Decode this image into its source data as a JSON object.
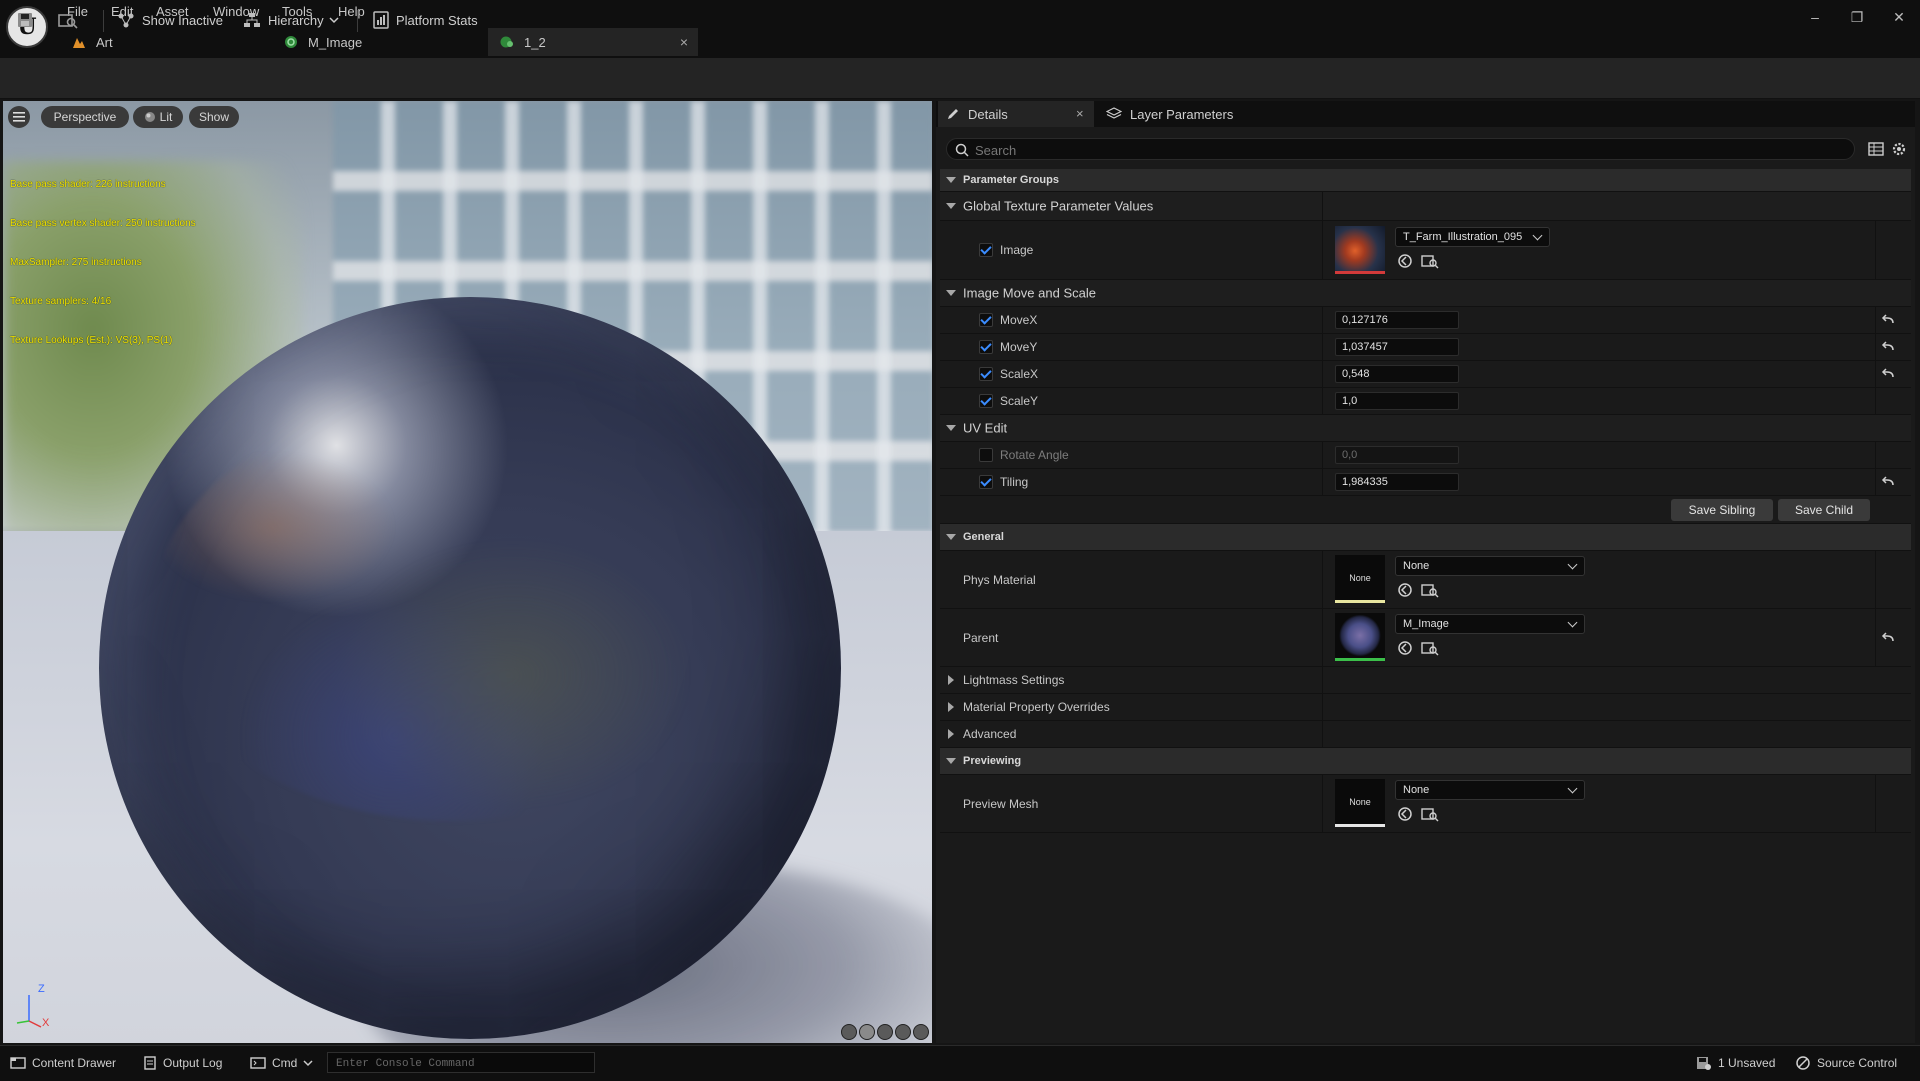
{
  "menu": [
    "File",
    "Edit",
    "Asset",
    "Window",
    "Tools",
    "Help"
  ],
  "tabs": [
    {
      "label": "Art",
      "icon": "level-icon"
    },
    {
      "label": "M_Image",
      "icon": "material-icon"
    },
    {
      "label": "1_2",
      "icon": "material-instance-icon"
    }
  ],
  "tab_close": "×",
  "window_controls": {
    "minimize": "–",
    "restore": "❐",
    "close": "✕"
  },
  "toolbar": {
    "show_inactive": "Show Inactive",
    "hierarchy": "Hierarchy",
    "platform_stats": "Platform Stats"
  },
  "viewport": {
    "perspective": "Perspective",
    "lit": "Lit",
    "show": "Show",
    "stats": [
      "Base pass shader: 226 instructions",
      "Base pass vertex shader: 250 instructions",
      "MaxSampler: 275 instructions",
      "Texture samplers: 4/16",
      "Texture Lookups (Est.): VS(3), PS(1)"
    ],
    "axis": {
      "z": "Z",
      "x": "X"
    }
  },
  "details": {
    "tab_details": "Details",
    "tab_layer_params": "Layer Parameters",
    "search_placeholder": "Search",
    "parameter_groups": "Parameter Groups",
    "global_texture": "Global Texture Parameter Values",
    "image_label": "Image",
    "image_value": "T_Farm_Illustration_095",
    "move_scale": "Image Move and Scale",
    "params": [
      {
        "name": "MoveX",
        "value": "0,127176",
        "checked": true
      },
      {
        "name": "MoveY",
        "value": "1,037457",
        "checked": true
      },
      {
        "name": "ScaleX",
        "value": "0,548",
        "checked": true
      },
      {
        "name": "ScaleY",
        "value": "1,0",
        "checked": true
      }
    ],
    "uv_edit": "UV Edit",
    "rotate_angle": {
      "name": "Rotate Angle",
      "value": "0,0",
      "checked": false
    },
    "tiling": {
      "name": "Tiling",
      "value": "1,984335",
      "checked": true
    },
    "save_sibling": "Save Sibling",
    "save_child": "Save Child",
    "general": "General",
    "phys_material": "Phys Material",
    "phys_value": "None",
    "none_thumb": "None",
    "parent": "Parent",
    "parent_value": "M_Image",
    "lightmass": "Lightmass Settings",
    "material_overrides": "Material Property Overrides",
    "advanced": "Advanced",
    "previewing": "Previewing",
    "preview_mesh": "Preview Mesh",
    "preview_value": "None"
  },
  "status": {
    "content_drawer": "Content Drawer",
    "output_log": "Output Log",
    "cmd": "Cmd",
    "console_placeholder": "Enter Console Command",
    "unsaved": "1 Unsaved",
    "source_control": "Source Control"
  },
  "colors": {
    "accent": "#3b8cff",
    "stats_text": "#f3e600"
  }
}
